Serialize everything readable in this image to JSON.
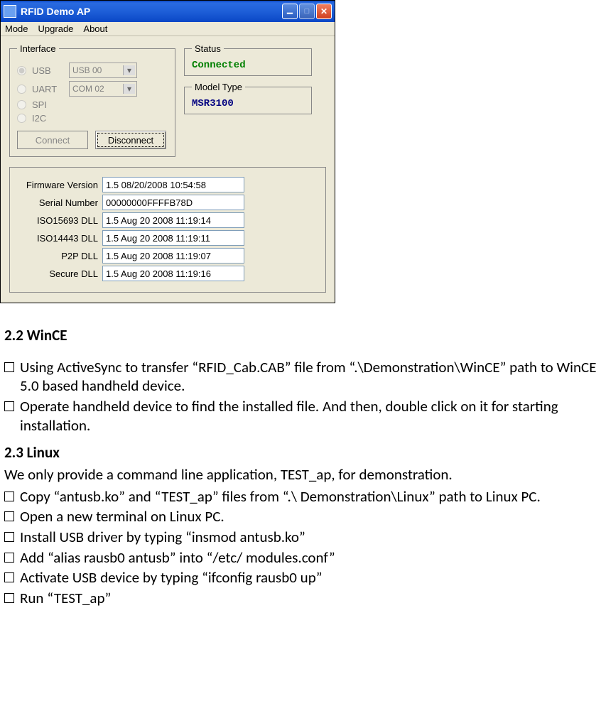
{
  "window": {
    "title": "RFID Demo AP",
    "menus": [
      "Mode",
      "Upgrade",
      "About"
    ]
  },
  "interface": {
    "legend": "Interface",
    "radios": {
      "usb": "USB",
      "uart": "UART",
      "spi": "SPI",
      "i2c": "I2C"
    },
    "usb_combo": "USB 00",
    "uart_combo": "COM 02",
    "connect": "Connect",
    "disconnect": "Disconnect"
  },
  "status": {
    "legend": "Status",
    "value": "Connected"
  },
  "model": {
    "legend": "Model Type",
    "value": "MSR3100"
  },
  "info": {
    "firmware": {
      "label": "Firmware Version",
      "value": "1.5 08/20/2008 10:54:58"
    },
    "serial": {
      "label": "Serial Number",
      "value": "00000000FFFFB78D"
    },
    "iso15693": {
      "label": "ISO15693 DLL",
      "value": "1.5  Aug 20 2008 11:19:14"
    },
    "iso14443": {
      "label": "ISO14443 DLL",
      "value": "1.5  Aug 20 2008 11:19:11"
    },
    "p2p": {
      "label": "P2P DLL",
      "value": "1.5  Aug 20 2008 11:19:07"
    },
    "secure": {
      "label": "Secure DLL",
      "value": "1.5  Aug 20 2008 11:19:16"
    }
  },
  "doc": {
    "h_wince": "2.2 WinCE",
    "wince1": "Using ActiveSync to transfer “RFID_Cab.CAB” file from “.\\Demonstration\\WinCE” path to WinCE 5.0 based handheld device.",
    "wince2": "Operate handheld device to find the installed file. And then, double click on it for starting installation.",
    "h_linux": "2.3 Linux",
    "linux_intro": "We only provide a command line application, TEST_ap, for demonstration.",
    "linux1": "Copy “antusb.ko” and “TEST_ap” files from “.\\ Demonstration\\Linux” path to Linux PC.",
    "linux2": "Open a new terminal on Linux PC.",
    "linux3": "Install USB driver by typing “insmod antusb.ko”",
    "linux4": "Add “alias rausb0 antusb” into “/etc/ modules.conf”",
    "linux5": "Activate USB device by typing “ifconfig rausb0 up”",
    "linux6": "Run “TEST_ap”"
  }
}
